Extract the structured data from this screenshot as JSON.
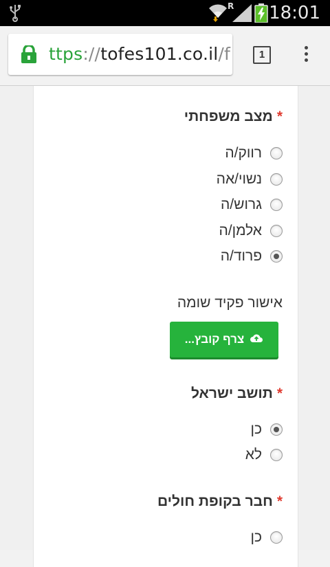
{
  "status_bar": {
    "time": "18:01",
    "icons": [
      "usb-icon",
      "wifi-icon",
      "roaming-indicator",
      "signal-icon",
      "battery-charging-icon"
    ],
    "roaming": "R"
  },
  "browser": {
    "url_scheme": "ttps",
    "url_sep": "://",
    "url_host": "tofes101.co.il",
    "url_tail": "/f",
    "tab_count": "1",
    "colors": {
      "secure": "#2aa33a"
    }
  },
  "form": {
    "required_marker": "*",
    "marital_status": {
      "label": "מצב משפחתי",
      "options": [
        {
          "label": "רווק/ה",
          "checked": false
        },
        {
          "label": "נשוי/אה",
          "checked": false
        },
        {
          "label": "גרוש/ה",
          "checked": false
        },
        {
          "label": "אלמן/ה",
          "checked": false
        },
        {
          "label": "פרוד/ה",
          "checked": true
        }
      ]
    },
    "guardian_approval": {
      "label": "אישור פקיד שומה",
      "button_label": "צרף קובץ...",
      "button_icon": "cloud-upload-icon",
      "button_color": "#26b33c"
    },
    "israeli_resident": {
      "label": "תושב ישראל",
      "options": [
        {
          "label": "כן",
          "checked": true
        },
        {
          "label": "לא",
          "checked": false
        }
      ]
    },
    "health_fund_member": {
      "label": "חבר בקופת חולים",
      "options": [
        {
          "label": "כן",
          "checked": false
        }
      ]
    }
  }
}
